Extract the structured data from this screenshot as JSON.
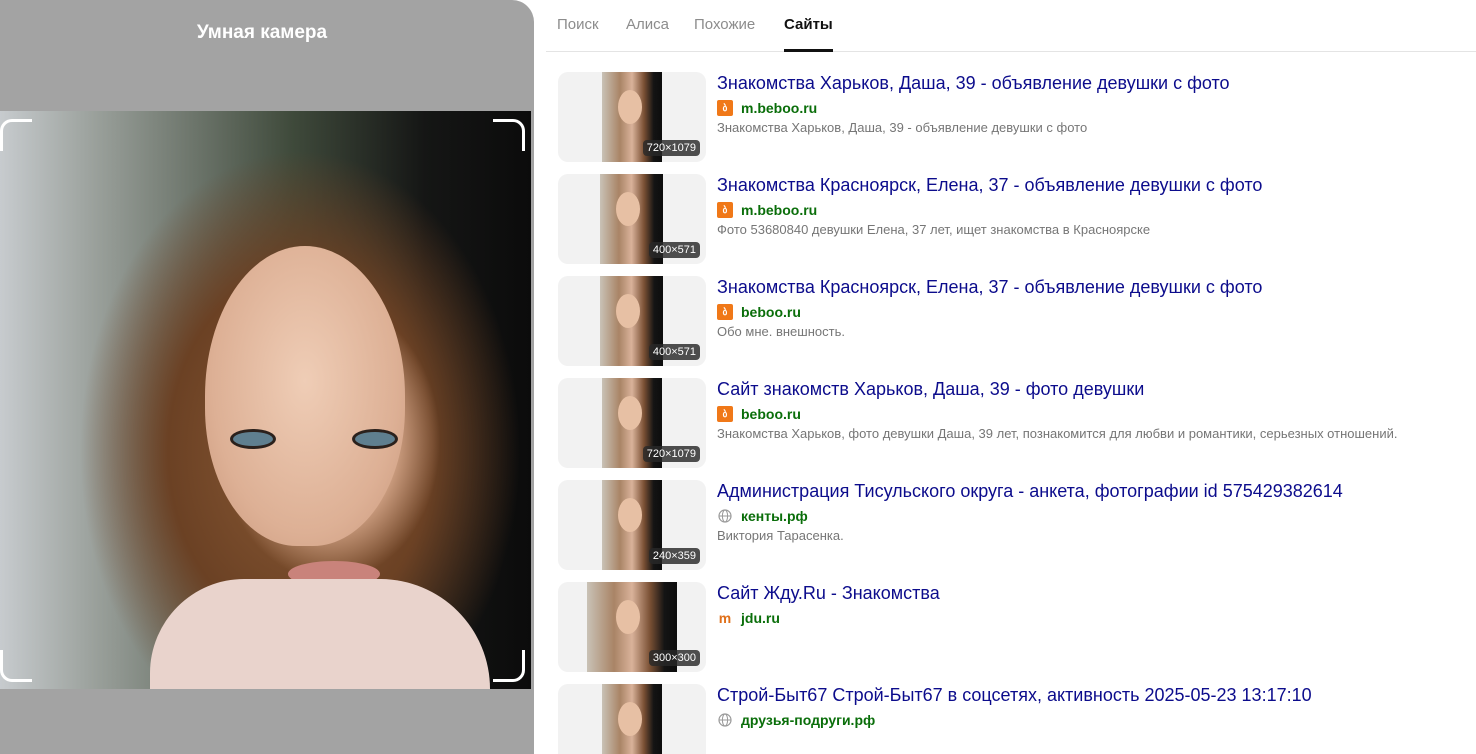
{
  "camera": {
    "title": "Умная камера"
  },
  "tabs": [
    {
      "label": "Поиск"
    },
    {
      "label": "Алиса"
    },
    {
      "label": "Похожие"
    },
    {
      "label": "Сайты"
    }
  ],
  "results": [
    {
      "title": "Знакомства Харьков, Даша, 39 - объявление девушки с фото",
      "host": "m.beboo.ru",
      "favicon": "beboo-icon",
      "snippet": "Знакомства Харьков, Даша, 39 - объявление девушки с фото",
      "size": "720×1079"
    },
    {
      "title": "Знакомства Красноярск, Елена, 37 - объявление девушки с фото",
      "host": "m.beboo.ru",
      "favicon": "beboo-icon",
      "snippet": "Фото 53680840 девушки Елена, 37 лет, ищет знакомства в Красноярске",
      "size": "400×571"
    },
    {
      "title": "Знакомства Красноярск, Елена, 37 - объявление девушки с фото",
      "host": "beboo.ru",
      "favicon": "beboo-icon",
      "snippet": "Обо мне. внешность.",
      "size": "400×571"
    },
    {
      "title": "Сайт знакомств Харьков, Даша, 39 - фото девушки",
      "host": "beboo.ru",
      "favicon": "beboo-icon",
      "snippet": "Знакомства Харьков, фото девушки Даша, 39 лет, познакомится для любви и романтики, серьезных отношений.",
      "size": "720×1079"
    },
    {
      "title": "Администрация Тисульского округа - анкета, фотографии id 575429382614",
      "host": "кенты.рф",
      "favicon": "globe-icon",
      "snippet": "Виктория Тарасенка.",
      "size": "240×359"
    },
    {
      "title": "Сайт Жду.Ru - Знакомства",
      "host": "jdu.ru",
      "favicon": "jdu-icon",
      "snippet": "",
      "size": "300×300"
    },
    {
      "title": "Строй-Быт67 Строй-Быт67 в соцсетях, активность 2025-05-23 13:17:10",
      "host": "друзья-подруги.рф",
      "favicon": "globe-icon",
      "snippet": "",
      "size": ""
    }
  ]
}
